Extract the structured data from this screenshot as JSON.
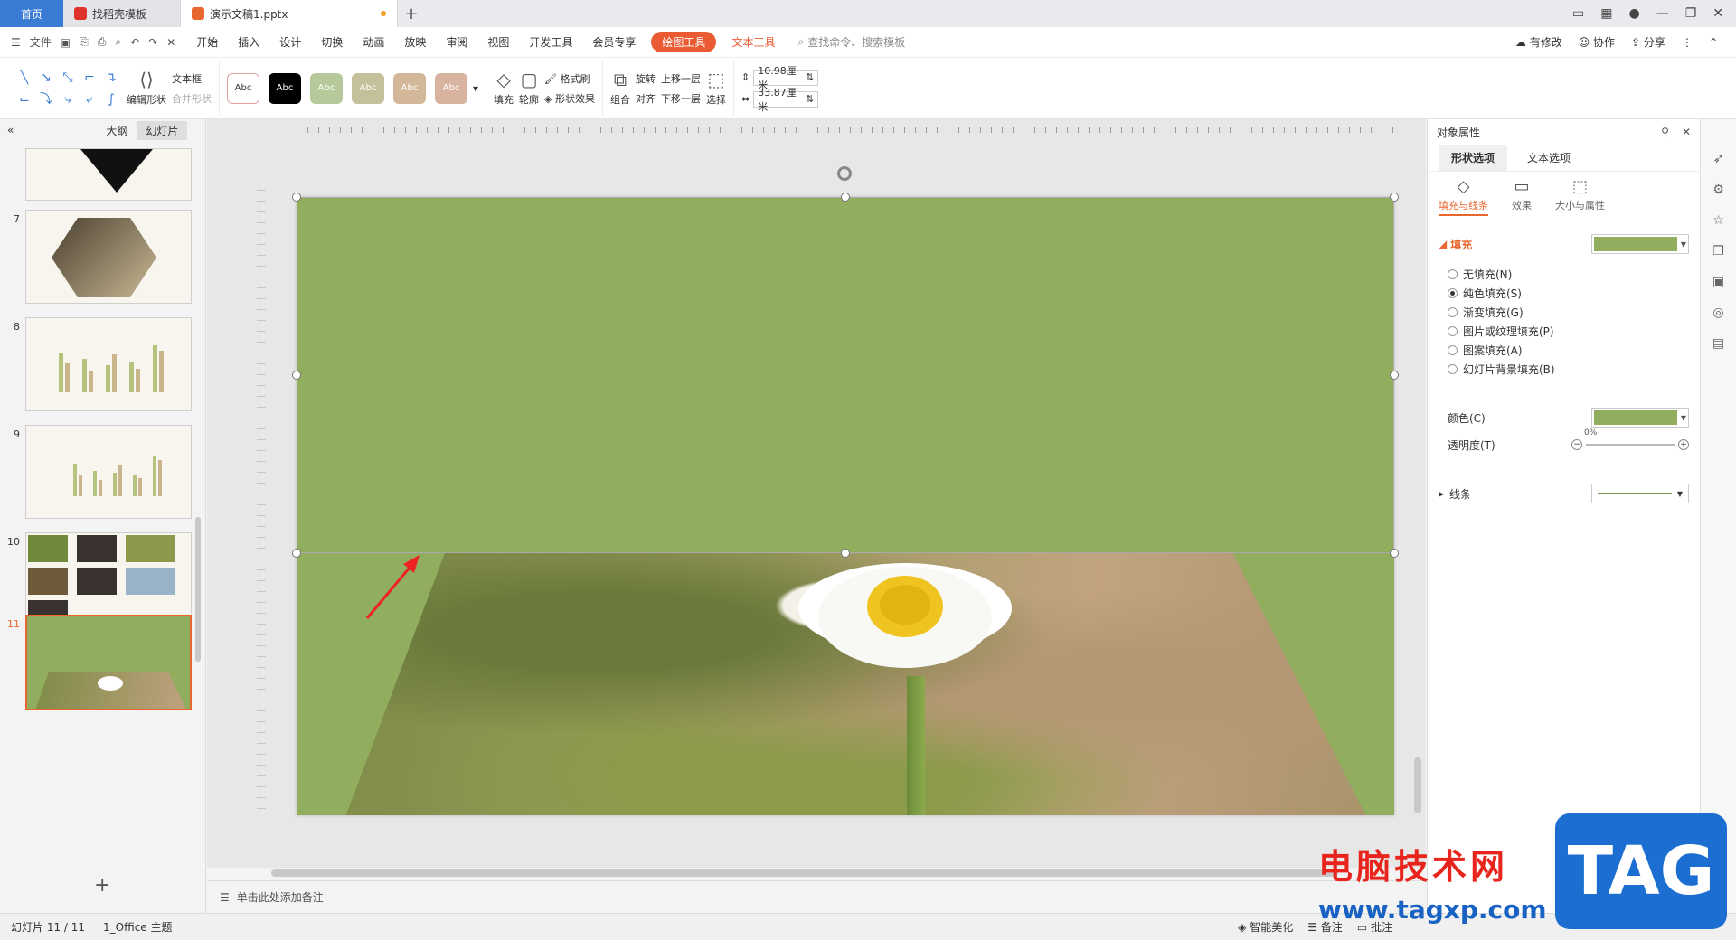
{
  "tabs": [
    {
      "label": "首页"
    },
    {
      "label": "找稻壳模板"
    },
    {
      "label": "演示文稿1.pptx"
    }
  ],
  "menu": {
    "file": "文件",
    "items": [
      "开始",
      "插入",
      "设计",
      "切换",
      "动画",
      "放映",
      "审阅",
      "视图",
      "开发工具",
      "会员专享"
    ],
    "drawing_tools": "绘图工具",
    "text_tools": "文本工具",
    "search": "查找命令、搜索模板",
    "has_changes": "有修改",
    "collaborate": "协作",
    "share": "分享"
  },
  "ribbon": {
    "edit_shape": "编辑形状",
    "text_box": "文本框",
    "merge_shape": "合并形状",
    "style_sample": "Abc",
    "style_colors": [
      "#ffffff",
      "#000000",
      "#b5c99a",
      "#c4c09a",
      "#d2b899",
      "#d8b4a0"
    ],
    "fill": "填充",
    "outline": "轮廓",
    "format_painter": "格式刷",
    "shape_effect": "形状效果",
    "group": "组合",
    "rotate": "旋转",
    "align": "对齐",
    "bring_forward": "上移一层",
    "send_backward": "下移一层",
    "select": "选择",
    "height": "10.98厘米",
    "width": "33.87厘米"
  },
  "left_panel": {
    "outline_tab": "大纲",
    "slides_tab": "幻灯片",
    "slide_numbers": [
      "7",
      "8",
      "9",
      "10",
      "11"
    ],
    "add_slide": "+"
  },
  "canvas": {
    "slide_bg_color": "#91ad5e",
    "notes_placeholder": "单击此处添加备注"
  },
  "right_pane": {
    "title": "对象属性",
    "tab_shape": "形状选项",
    "tab_text": "文本选项",
    "sub_fill_line": "填充与线条",
    "sub_effect": "效果",
    "sub_size": "大小与属性",
    "fill_section": "填充",
    "fill_color": "#91ad5e",
    "fill_options": [
      "无填充(N)",
      "纯色填充(S)",
      "渐变填充(G)",
      "图片或纹理填充(P)",
      "图案填充(A)",
      "幻灯片背景填充(B)"
    ],
    "selected_fill_index": 1,
    "color_label": "颜色(C)",
    "transparency_label": "透明度(T)",
    "transparency_value": "0%",
    "line_section": "线条"
  },
  "status": {
    "slide_info": "幻灯片 11 / 11",
    "theme": "1_Office 主题",
    "beautify": "智能美化",
    "notes": "备注",
    "comment": "批注"
  },
  "watermark": {
    "site_cn": "电脑技术网",
    "url": "www.tagxp.com",
    "tag": "TAG"
  }
}
